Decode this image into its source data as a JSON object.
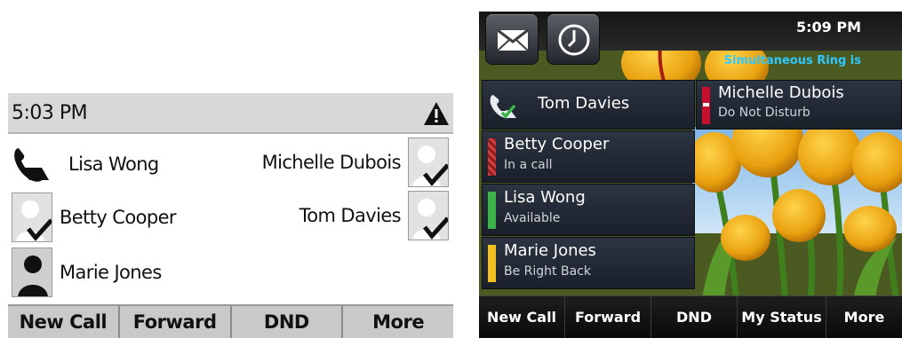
{
  "mono_phone": {
    "time": "5:03 PM",
    "contacts": [
      {
        "name": "Lisa Wong"
      },
      {
        "name": "Michelle Dubois"
      },
      {
        "name": "Betty Cooper"
      },
      {
        "name": "Tom Davies"
      },
      {
        "name": "Marie Jones"
      }
    ],
    "softkeys": [
      "New Call",
      "Forward",
      "DND",
      "More"
    ]
  },
  "color_phone": {
    "time": "5:09 PM",
    "ticker": "Simultaneous Ring is",
    "lines": [
      {
        "name": "Tom Davies",
        "status": ""
      },
      {
        "name": "Michelle Dubois",
        "status": "Do Not Disturb"
      },
      {
        "name": "Betty Cooper",
        "status": "In a call"
      },
      {
        "name": "Lisa Wong",
        "status": "Available"
      },
      {
        "name": "Marie Jones",
        "status": "Be Right Back"
      }
    ],
    "softkeys": [
      "New Call",
      "Forward",
      "DND",
      "My Status",
      "More"
    ],
    "colors": {
      "available": "#3bb54a",
      "busy": "#d23c3c",
      "dnd": "#c8102e",
      "brb": "#f2c01e",
      "ticker": "#2ec8ff"
    }
  }
}
